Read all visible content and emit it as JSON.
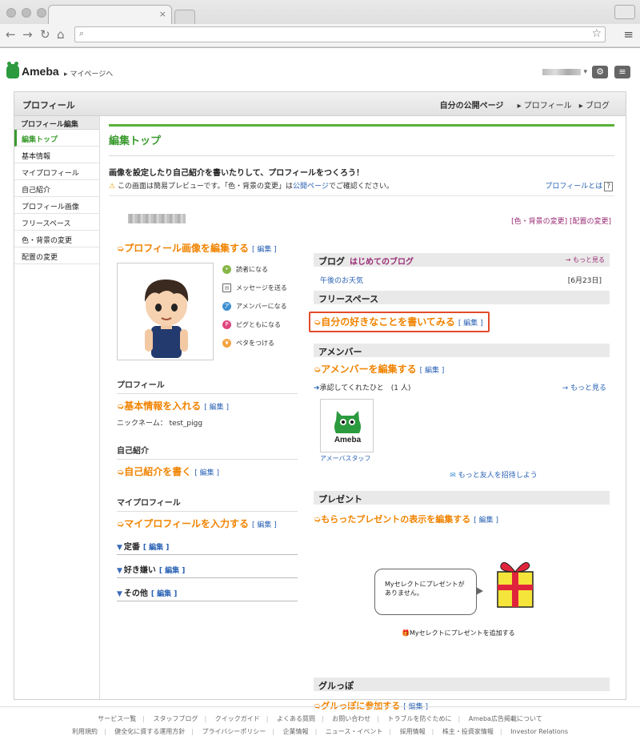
{
  "browser": {
    "close_tab": "×"
  },
  "header": {
    "logo": "Ameba",
    "mypage": "▸ マイページへ",
    "user": "▾",
    "gear": "⚙",
    "list": "≡"
  },
  "panel": {
    "title": "プロフィール",
    "links": {
      "public": "自分の公開ページ",
      "profile": "▸ プロフィール",
      "blog": "▸ ブログ"
    }
  },
  "sidebar": {
    "header": "プロフィール編集",
    "items": [
      "編集トップ",
      "基本情報",
      "マイプロフィール",
      "自己紹介",
      "プロフィール画像",
      "フリースペース",
      "色・背景の変更",
      "配置の変更"
    ]
  },
  "main": {
    "title": "編集トップ",
    "intro": "画像を設定したり自己紹介を書いたりして、プロフィールをつくろう！",
    "notice_pre": "この画面は簡易プレビューです。「色・背景の変更」は",
    "notice_link": "公開ページ",
    "notice_post": "でご確認ください。",
    "about": "プロフィールとは",
    "color_links": "[色・背景の変更] [配置の変更]"
  },
  "left": {
    "image_edit": "プロフィール画像を編集する",
    "edit": "[ 編集 ]",
    "actions": [
      "読者になる",
      "メッセージを送る",
      "アメンバーになる",
      "ピグともになる",
      "ペタをつける"
    ],
    "profile_title": "プロフィール",
    "basic": "基本情報を入れる",
    "nickname_label": "ニックネーム：",
    "nickname": "test_pigg",
    "intro_title": "自己紹介",
    "intro_write": "自己紹介を書く",
    "myprofile_title": "マイプロフィール",
    "myprofile_input": "マイプロフィールを入力する",
    "toggles": [
      "定番",
      "好き嫌い",
      "その他"
    ]
  },
  "right": {
    "blog_title": "ブログ",
    "blog_name": "はじめてのブログ",
    "more": "→ もっと見る",
    "blog_entry": "午後のお天気",
    "blog_date": "[6月23日]",
    "free_title": "フリースペース",
    "free_write": "自分の好きなことを書いてみる",
    "amember_title": "アメンバー",
    "amember_edit": "アメンバーを編集する",
    "approved": "承認してくれたひと　(1 人)",
    "staff_logo": "Ameba",
    "staff_name": "アメーバスタッフ",
    "invite": "もっと友人を招待しよう",
    "present_title": "プレゼント",
    "present_edit": "もらったプレゼントの表示を編集する",
    "bubble": "Myセレクトにプレゼントが ありません。",
    "add_present": "Myセレクトにプレゼントを追加する",
    "gurupo_title": "グルっぽ",
    "gurupo_join": "グルっぽに参加する"
  },
  "footer": {
    "row1": [
      "サービス一覧",
      "スタッフブログ",
      "クイックガイド",
      "よくある質問",
      "お問い合わせ",
      "トラブルを防ぐために",
      "Ameba広告掲載について"
    ],
    "row2": [
      "利用規約",
      "健全化に資する運用方針",
      "プライバシーポリシー",
      "企業情報",
      "ニュース・イベント",
      "採用情報",
      "株主・投資家情報",
      "Investor Relations"
    ]
  },
  "colors": {
    "green": "#3a9a2e",
    "orange": "#f08300",
    "link": "#2a62b5",
    "purple": "#9a2b75",
    "highlight": "#e24c2a"
  }
}
